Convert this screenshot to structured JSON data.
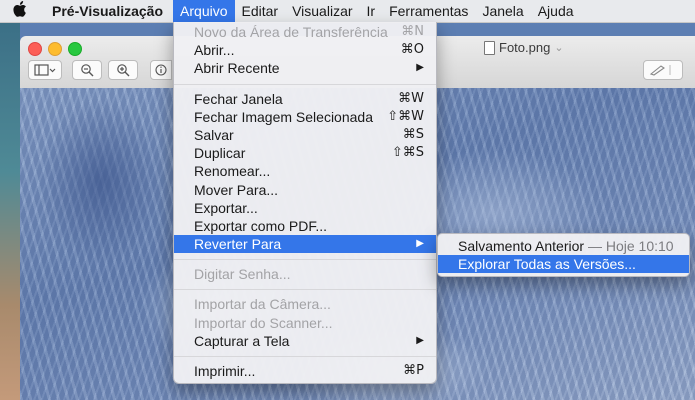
{
  "menubar": {
    "apple_icon": "apple-icon",
    "app_name": "Pré-Visualização",
    "items": [
      "Arquivo",
      "Editar",
      "Visualizar",
      "Ir",
      "Ferramentas",
      "Janela",
      "Ajuda"
    ]
  },
  "window": {
    "title": "Foto.png",
    "title_chevron": "⌄"
  },
  "file_menu": {
    "new_from_clipboard": {
      "label": "Novo da Área de Transferência",
      "shortcut": "⌘N"
    },
    "open": {
      "label": "Abrir...",
      "shortcut": "⌘O"
    },
    "open_recent": {
      "label": "Abrir Recente"
    },
    "close_window": {
      "label": "Fechar Janela",
      "shortcut": "⌘W"
    },
    "close_image": {
      "label": "Fechar Imagem Selecionada",
      "shortcut": "⇧⌘W"
    },
    "save": {
      "label": "Salvar",
      "shortcut": "⌘S"
    },
    "duplicate": {
      "label": "Duplicar",
      "shortcut": "⇧⌘S"
    },
    "rename": {
      "label": "Renomear..."
    },
    "move_to": {
      "label": "Mover Para..."
    },
    "export": {
      "label": "Exportar..."
    },
    "export_pdf": {
      "label": "Exportar como PDF..."
    },
    "revert_to": {
      "label": "Reverter Para"
    },
    "enter_password": {
      "label": "Digitar Senha..."
    },
    "import_camera": {
      "label": "Importar da Câmera..."
    },
    "import_scanner": {
      "label": "Importar do Scanner..."
    },
    "take_screenshot": {
      "label": "Capturar a Tela"
    },
    "print": {
      "label": "Imprimir...",
      "shortcut": "⌘P"
    }
  },
  "revert_submenu": {
    "last_saved": {
      "label": "Salvamento Anterior",
      "detail": "— Hoje 10:10"
    },
    "browse_versions": {
      "label": "Explorar Todas as Versões..."
    }
  },
  "colors": {
    "highlight": "#3476e9",
    "disabled_text": "#a3a3a6"
  }
}
